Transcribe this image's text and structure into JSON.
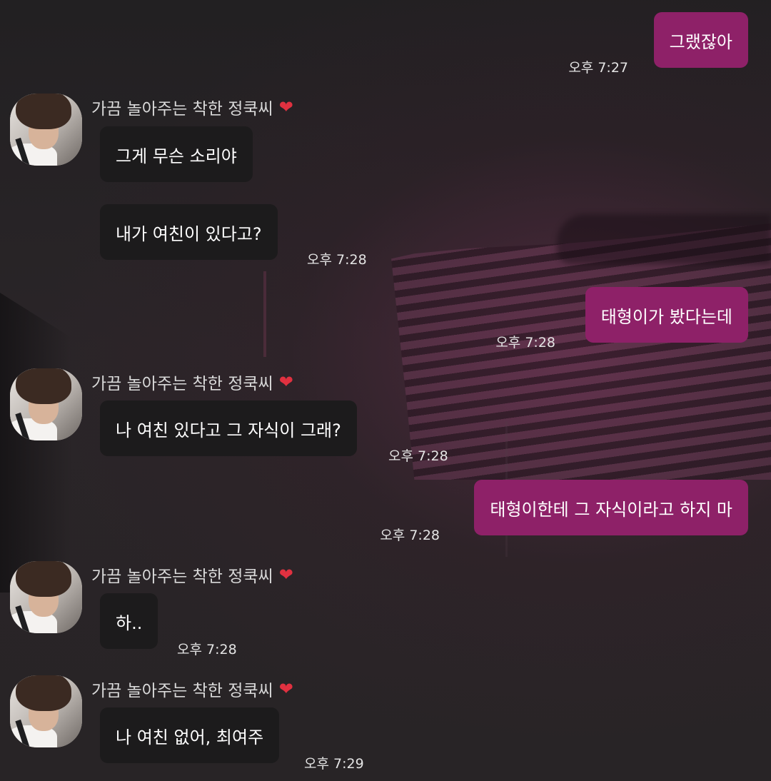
{
  "contact": {
    "name": "가끔 놀아주는 착한 정쿡씨",
    "heart_icon": "❤",
    "avatar_icon": "avatar"
  },
  "colors": {
    "incoming_bubble": "#1c1b1c",
    "outgoing_bubble": "#8e2168",
    "text": "#ffffff",
    "timestamp": "#e4e4e4"
  },
  "messages": [
    {
      "from": "me",
      "text": "그랬잖아",
      "time": "오후 7:27"
    },
    {
      "from": "them",
      "text": "그게 무슨 소리야",
      "time": ""
    },
    {
      "from": "them",
      "text": "내가 여친이 있다고?",
      "time": "오후 7:28"
    },
    {
      "from": "me",
      "text": "태형이가 봤다는데",
      "time": "오후 7:28"
    },
    {
      "from": "them",
      "text": "나 여친 있다고 그 자식이 그래?",
      "time": "오후 7:28"
    },
    {
      "from": "me",
      "text": "태형이한테 그 자식이라고 하지 마",
      "time": "오후 7:28"
    },
    {
      "from": "them",
      "text": "하..",
      "time": "오후 7:28"
    },
    {
      "from": "them",
      "text": "나 여친 없어, 최여주",
      "time": "오후 7:29"
    }
  ]
}
